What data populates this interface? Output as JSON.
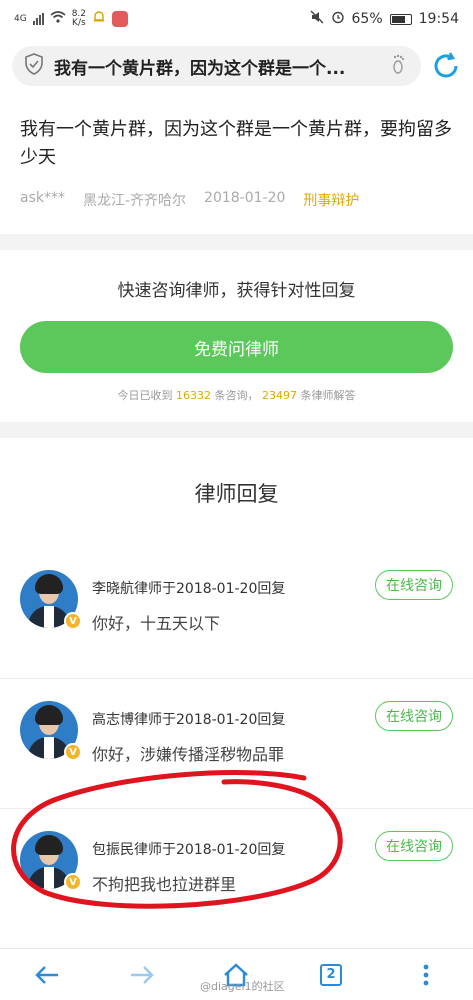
{
  "status_bar": {
    "network": "4G",
    "net_speed_value": "8.2",
    "net_speed_unit": "K/s",
    "battery_percent": "65%",
    "time": "19:54"
  },
  "address_bar": {
    "title": "我有一个黄片群，因为这个群是一个..."
  },
  "question": {
    "text": "我有一个黄片群，因为这个群是一个黄片群，要拘留多少天",
    "user": "ask***",
    "location": "黑龙江-齐齐哈尔",
    "date": "2018-01-20",
    "category": "刑事辩护"
  },
  "cta": {
    "title": "快速咨询律师，获得针对性回复",
    "button": "免费问律师",
    "stats_prefix": "今日已收到",
    "consultations": "16332",
    "stats_mid": "条咨询，",
    "answers": "23497",
    "stats_suffix": "条律师解答"
  },
  "replies": {
    "title": "律师回复",
    "items": [
      {
        "header": "李晓航律师于2018-01-20回复",
        "text": "你好，十五天以下",
        "button": "在线咨询",
        "badge": "V"
      },
      {
        "header": "高志博律师于2018-01-20回复",
        "text": "你好，涉嫌传播淫秽物品罪",
        "button": "在线咨询",
        "badge": "V"
      },
      {
        "header": "包振民律师于2018-01-20回复",
        "text": "不拘把我也拉进群里",
        "button": "在线咨询",
        "badge": "V"
      }
    ]
  },
  "bottom_nav": {
    "tab_count": "2",
    "watermark": "@diagei1的社区"
  },
  "colors": {
    "accent_green": "#5cc85c",
    "highlight_yellow": "#e0a800",
    "nav_blue": "#2a8bd8",
    "annotation_red": "#e0141e"
  }
}
